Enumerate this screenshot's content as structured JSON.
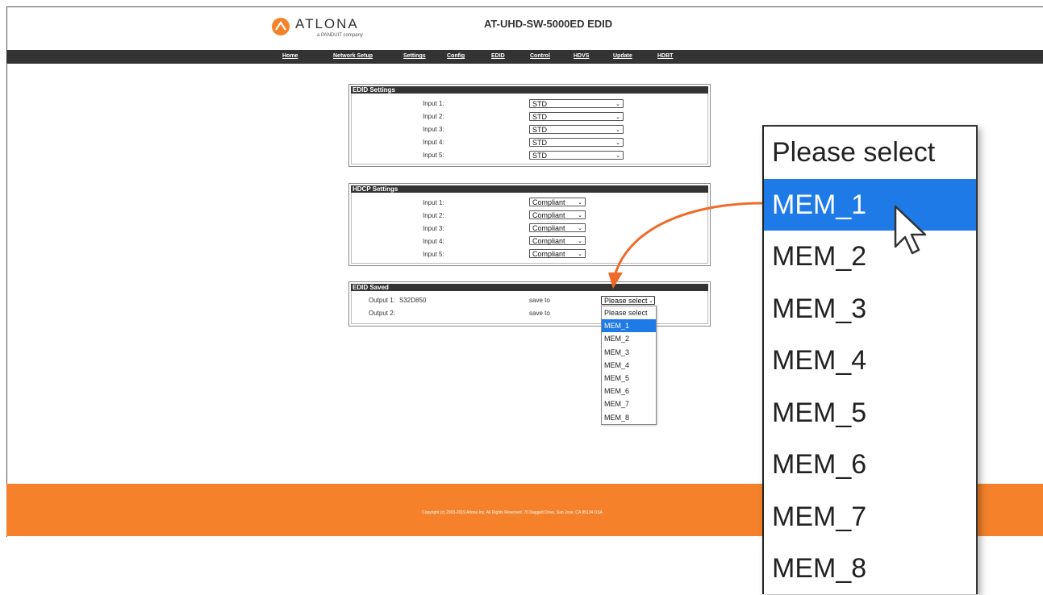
{
  "header": {
    "brand": "ATLONA",
    "brand_sub": "a PANDUIT company",
    "title": "AT-UHD-SW-5000ED EDID"
  },
  "nav": {
    "items": [
      "Home",
      "Network Setup",
      "Settings",
      "Config",
      "EDID",
      "Control",
      "HDVS",
      "Update",
      "HDBT"
    ]
  },
  "edid_settings": {
    "heading": "EDID Settings",
    "rows": [
      {
        "label": "Input 1:",
        "value": "STD"
      },
      {
        "label": "Input 2:",
        "value": "STD"
      },
      {
        "label": "Input 3:",
        "value": "STD"
      },
      {
        "label": "Input 4:",
        "value": "STD"
      },
      {
        "label": "Input 5:",
        "value": "STD"
      }
    ]
  },
  "hdcp_settings": {
    "heading": "HDCP Settings",
    "rows": [
      {
        "label": "Input 1:",
        "value": "Compliant"
      },
      {
        "label": "Input 2:",
        "value": "Compliant"
      },
      {
        "label": "Input 3:",
        "value": "Compliant"
      },
      {
        "label": "Input 4:",
        "value": "Compliant"
      },
      {
        "label": "Input 5:",
        "value": "Compliant"
      }
    ]
  },
  "edid_saved": {
    "heading": "EDID Saved",
    "rows": [
      {
        "label": "Output 1:",
        "device": "S32D850",
        "save_label": "save to",
        "select_value": "Please select"
      },
      {
        "label": "Output 2:",
        "device": "",
        "save_label": "save to"
      }
    ],
    "dropdown_options": [
      "Please select",
      "MEM_1",
      "MEM_2",
      "MEM_3",
      "MEM_4",
      "MEM_5",
      "MEM_6",
      "MEM_7",
      "MEM_8"
    ],
    "highlighted_option": "MEM_1"
  },
  "footer": {
    "copyright": "Copyright (c) 2003-2019 Atlona Inc. All Rights Reserved. 70 Daggett Drive, San Jose, CA 95134 USA"
  },
  "colors": {
    "accent_orange": "#f5822a",
    "nav_bg": "#333333",
    "highlight_blue": "#1e7ae6"
  },
  "icons": [
    "atlona-logo-icon",
    "chevron-down-icon",
    "mouse-pointer-icon",
    "callout-arrow-icon"
  ]
}
